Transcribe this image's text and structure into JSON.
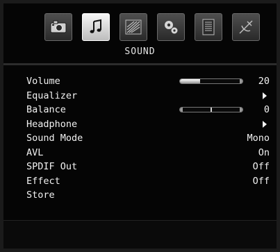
{
  "menu": {
    "tabs": [
      {
        "icon": "camera-icon",
        "active": false
      },
      {
        "icon": "music-note-icon",
        "active": true
      },
      {
        "icon": "picture-settings-icon",
        "active": false
      },
      {
        "icon": "gears-icon",
        "active": false
      },
      {
        "icon": "document-icon",
        "active": false
      },
      {
        "icon": "satellite-icon",
        "active": false
      }
    ],
    "title": "SOUND"
  },
  "items": [
    {
      "label": "Volume",
      "value": "20",
      "level": 0.32
    },
    {
      "label": "Equalizer",
      "submenu": true
    },
    {
      "label": "Balance",
      "value": "0",
      "level": 0.5
    },
    {
      "label": "Headphone",
      "submenu": true
    },
    {
      "label": "Sound Mode",
      "value": "Mono"
    },
    {
      "label": "AVL",
      "value": "On"
    },
    {
      "label": "SPDIF Out",
      "value": "Off"
    },
    {
      "label": "Effect",
      "value": "Off"
    },
    {
      "label": "Store"
    }
  ]
}
